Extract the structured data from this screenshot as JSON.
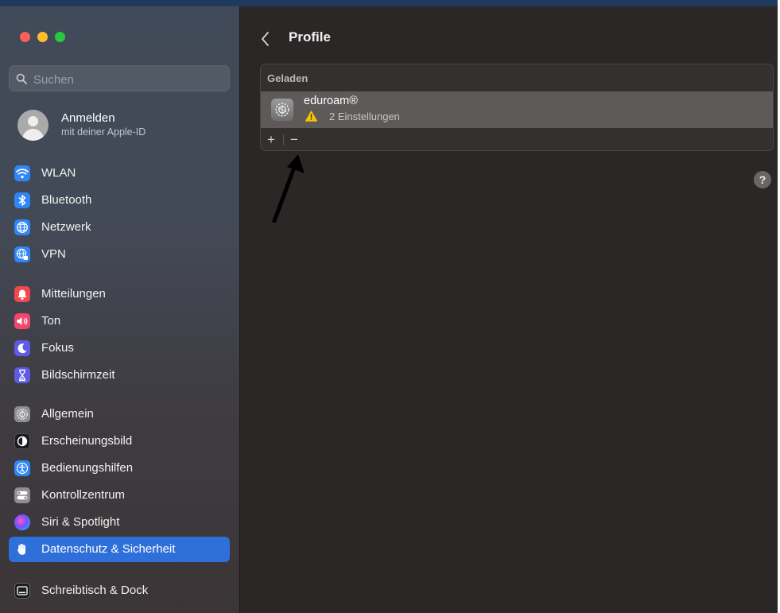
{
  "colors": {
    "accent": "#2f6fd9",
    "sidebar_bg": "#424956",
    "main_bg": "#2c2727",
    "warning": "#f5c400"
  },
  "search": {
    "placeholder": "Suchen"
  },
  "account": {
    "name": "Anmelden",
    "subtitle": "mit deiner Apple-ID"
  },
  "sidebar": {
    "items": [
      {
        "label": "WLAN",
        "icon": "wifi-icon"
      },
      {
        "label": "Bluetooth",
        "icon": "bluetooth-icon"
      },
      {
        "label": "Netzwerk",
        "icon": "globe-icon"
      },
      {
        "label": "VPN",
        "icon": "vpn-globe-icon"
      },
      {
        "label": "Mitteilungen",
        "icon": "bell-icon"
      },
      {
        "label": "Ton",
        "icon": "speaker-icon"
      },
      {
        "label": "Fokus",
        "icon": "moon-icon"
      },
      {
        "label": "Bildschirmzeit",
        "icon": "hourglass-icon"
      },
      {
        "label": "Allgemein",
        "icon": "gear-icon"
      },
      {
        "label": "Erscheinungsbild",
        "icon": "appearance-icon"
      },
      {
        "label": "Bedienungshilfen",
        "icon": "accessibility-icon"
      },
      {
        "label": "Kontrollzentrum",
        "icon": "toggles-icon"
      },
      {
        "label": "Siri & Spotlight",
        "icon": "siri-icon"
      },
      {
        "label": "Datenschutz & Sicherheit",
        "icon": "hand-icon",
        "selected": true
      },
      {
        "label": "Schreibtisch & Dock",
        "icon": "dock-icon"
      }
    ]
  },
  "main": {
    "title": "Profile",
    "section_header": "Geladen",
    "profile": {
      "name": "eduroam®",
      "settings_count": "2 Einstellungen",
      "icon": "gear-icon"
    },
    "toolbar": {
      "add": "+",
      "remove": "−"
    },
    "help": "?"
  }
}
